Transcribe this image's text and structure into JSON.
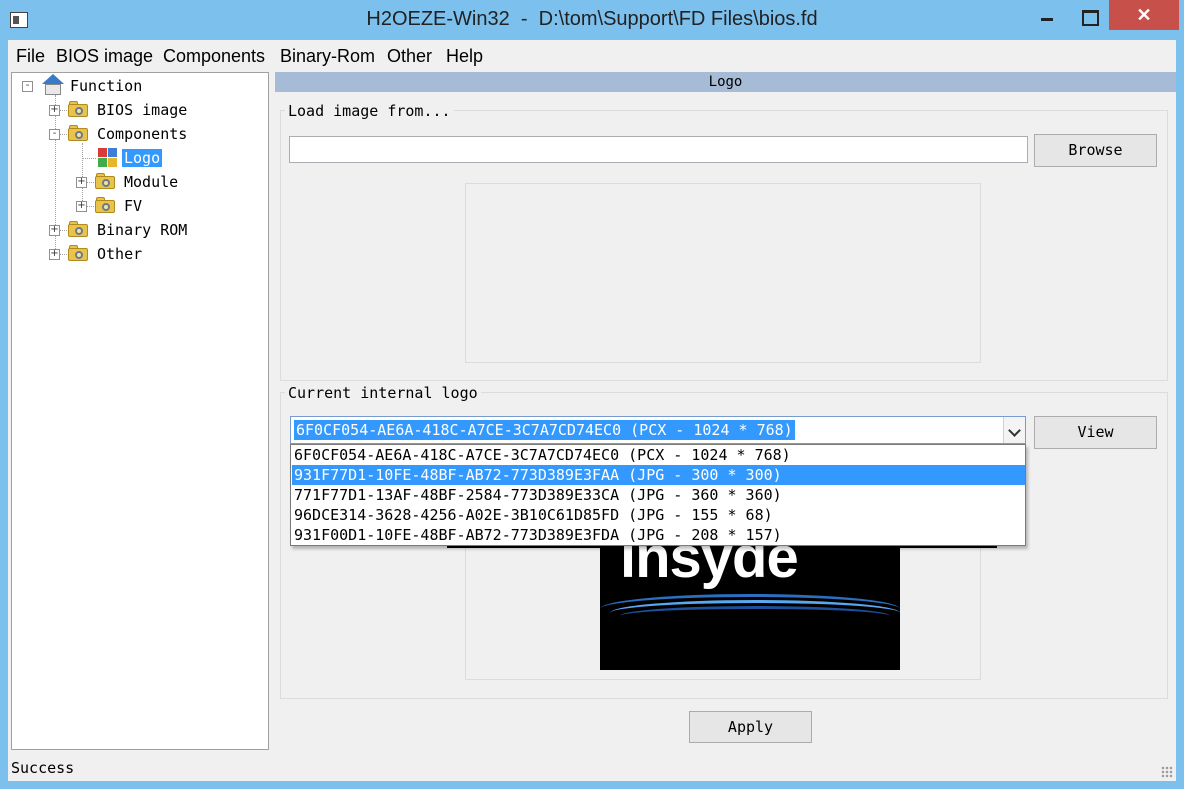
{
  "window": {
    "title": "H2OEZE-Win32  -  D:\\tom\\Support\\FD Files\\bios.fd",
    "close_glyph": "✕"
  },
  "menu": [
    {
      "label": "File"
    },
    {
      "label": "BIOS image"
    },
    {
      "label": "Components"
    },
    {
      "label": "Binary-Rom"
    },
    {
      "label": "Other"
    },
    {
      "label": "Help"
    }
  ],
  "tree": {
    "root": "Function",
    "items": [
      {
        "label": "BIOS image",
        "expander": "+"
      },
      {
        "label": "Components",
        "expander": "-"
      },
      {
        "label": "Logo",
        "selected": true
      },
      {
        "label": "Module",
        "expander": "+"
      },
      {
        "label": "FV",
        "expander": "+"
      },
      {
        "label": "Binary ROM",
        "expander": "+"
      },
      {
        "label": "Other",
        "expander": "+"
      }
    ]
  },
  "panel": {
    "header": "Logo",
    "load_group_label": "Load image from...",
    "path_value": "",
    "browse_label": "Browse",
    "current_group_label": "Current internal logo",
    "combo_value": "6F0CF054-AE6A-418C-A7CE-3C7A7CD74EC0 (PCX - 1024 * 768)",
    "view_label": "View",
    "dropdown_options": [
      "6F0CF054-AE6A-418C-A7CE-3C7A7CD74EC0 (PCX - 1024 * 768)",
      "931F77D1-10FE-48BF-AB72-773D389E3FAA (JPG - 300 * 300)",
      "771F77D1-13AF-48BF-2584-773D389E33CA (JPG - 360 * 360)",
      "96DCE314-3628-4256-A02E-3B10C61D85FD (JPG - 155 * 68)",
      "931F00D1-10FE-48BF-AB72-773D389E3FDA (JPG - 208 * 157)"
    ],
    "highlighted_option": 1,
    "logo_text": "insyde",
    "apply_label": "Apply"
  },
  "status": {
    "text": "Success"
  },
  "colors": {
    "titlebar": "#7cc0ee",
    "close_button": "#c7504a",
    "selection": "#3399ff",
    "panel_header": "#a6bbd6"
  }
}
